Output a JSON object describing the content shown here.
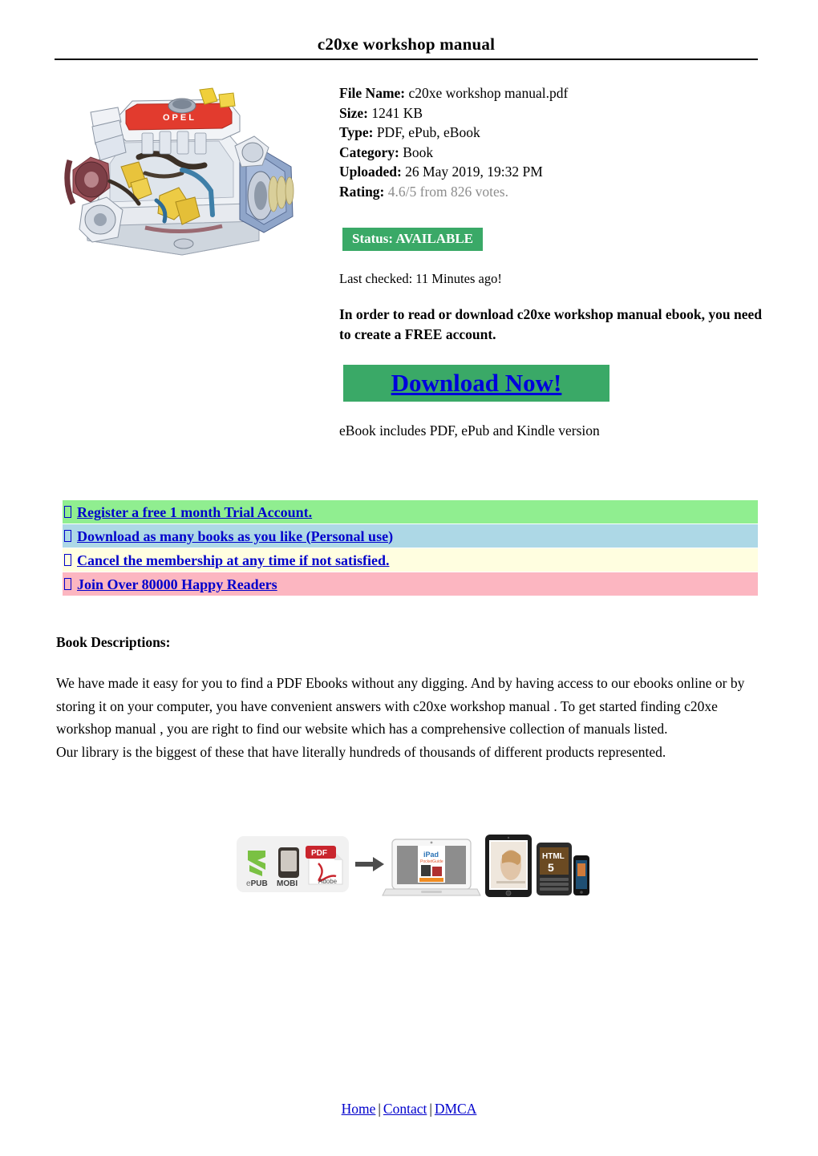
{
  "header": {
    "title": "c20xe workshop manual"
  },
  "cover": {
    "alt": "engine-cutaway-illustration",
    "badge_text": "OPEL"
  },
  "meta": {
    "rows": [
      {
        "key": "File Name:",
        "value": "c20xe workshop manual.pdf",
        "muted": false
      },
      {
        "key": "Size:",
        "value": "1241 KB",
        "muted": false
      },
      {
        "key": "Type:",
        "value": "PDF, ePub, eBook",
        "muted": false
      },
      {
        "key": "Category:",
        "value": "Book",
        "muted": false
      },
      {
        "key": "Uploaded:",
        "value": "26 May 2019, 19:32 PM",
        "muted": false
      },
      {
        "key": "Rating:",
        "value": "4.6/5 from 826 votes.",
        "muted": true
      }
    ]
  },
  "status": {
    "label": "Status: AVAILABLE",
    "color": "#3aa967"
  },
  "last_checked": "Last checked: 11 Minutes ago!",
  "notice": "In order to read or download c20xe workshop manual ebook, you need to create a FREE account.",
  "download": {
    "label": "Download Now!",
    "background": "#3aa967",
    "text_color": "#0000dd"
  },
  "includes_note": "eBook includes PDF, ePub and Kindle version",
  "benefits": [
    {
      "label": "Register a free 1 month Trial Account.",
      "color": "#90ee90"
    },
    {
      "label": "Download as many books as you like (Personal use)",
      "color": "#add8e6"
    },
    {
      "label": "Cancel the membership at any time if not satisfied.",
      "color": "#fffee0"
    },
    {
      "label": "Join Over 80000 Happy Readers",
      "color": "#fcb6c1"
    }
  ],
  "descriptions": {
    "heading": "Book Descriptions:",
    "paragraph1": "We have made it easy for you to find a PDF Ebooks without any digging. And by having access to our ebooks online or by storing it on your computer, you have convenient answers with c20xe workshop manual . To get started finding c20xe workshop manual , you are right to find our website which has a comprehensive collection of manuals listed.",
    "paragraph2": "Our library is the biggest of these that have literally hundreds of thousands of different products represented."
  },
  "devices": {
    "epub_label": "ePUB",
    "mobi_label": "MOBI",
    "pdf_label": "PDF",
    "adobe_label": "Adobe",
    "ipad_label": "iPad",
    "ipad_sub": "PocketGuide",
    "html_label": "HTML",
    "html_version": "5"
  },
  "footer": {
    "links": [
      {
        "label": "Home"
      },
      {
        "label": "Contact"
      },
      {
        "label": "DMCA"
      }
    ],
    "separator": "|"
  }
}
